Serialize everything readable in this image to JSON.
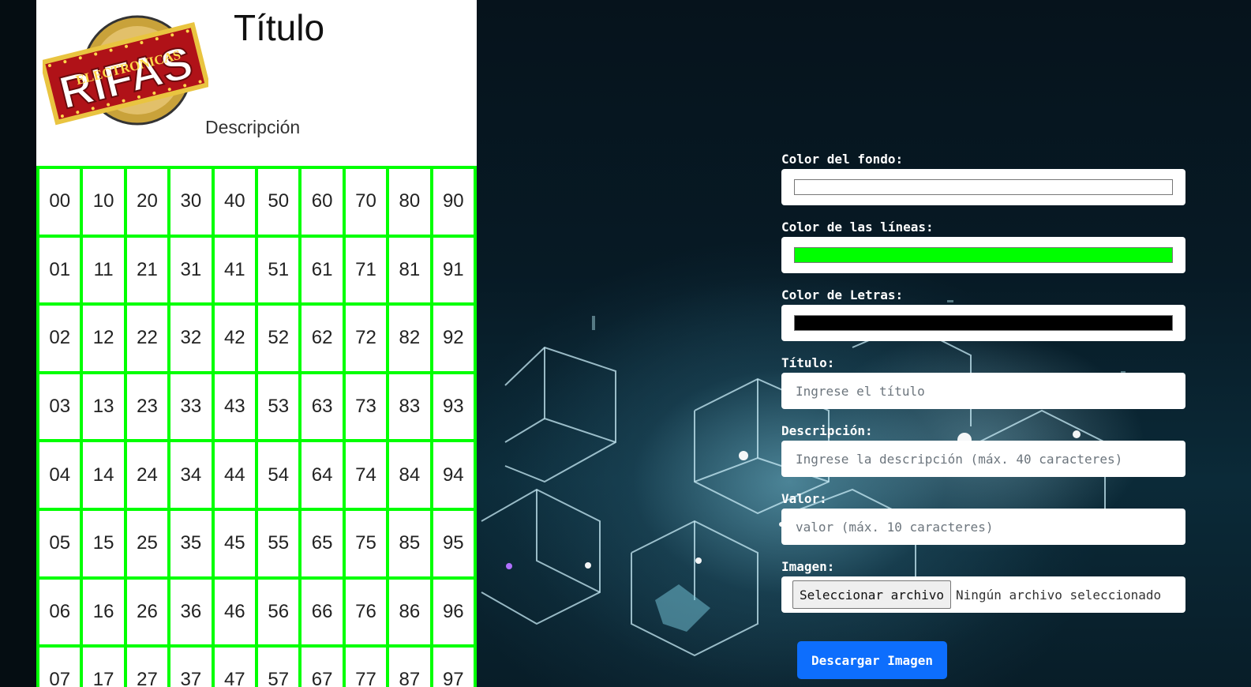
{
  "ticket": {
    "logo_text_main": "RIFAS",
    "logo_text_sub": "ELECTRONICAS",
    "title": "Título",
    "description": "Descripción",
    "numbers": [
      "00",
      "10",
      "20",
      "30",
      "40",
      "50",
      "60",
      "70",
      "80",
      "90",
      "01",
      "11",
      "21",
      "31",
      "41",
      "51",
      "61",
      "71",
      "81",
      "91",
      "02",
      "12",
      "22",
      "32",
      "42",
      "52",
      "62",
      "72",
      "82",
      "92",
      "03",
      "13",
      "23",
      "33",
      "43",
      "53",
      "63",
      "73",
      "83",
      "93",
      "04",
      "14",
      "24",
      "34",
      "44",
      "54",
      "64",
      "74",
      "84",
      "94",
      "05",
      "15",
      "25",
      "35",
      "45",
      "55",
      "65",
      "75",
      "85",
      "95",
      "06",
      "16",
      "26",
      "36",
      "46",
      "56",
      "66",
      "76",
      "86",
      "96",
      "07",
      "17",
      "27",
      "37",
      "47",
      "57",
      "67",
      "77",
      "87",
      "97"
    ],
    "colors": {
      "background": "#ffffff",
      "lines": "#00ff00",
      "letters": "#000000"
    }
  },
  "form": {
    "bg_color_label": "Color del fondo:",
    "bg_color_value": "#ffffff",
    "lines_color_label": "Color de las líneas:",
    "lines_color_value": "#00ff00",
    "letters_color_label": "Color de Letras:",
    "letters_color_value": "#000000",
    "title_label": "Título:",
    "title_placeholder": "Ingrese el título",
    "description_label": "Descripción:",
    "description_placeholder": "Ingrese la descripción (máx. 40 caracteres)",
    "value_label": "Valor:",
    "value_placeholder": "valor (máx. 10 caracteres)",
    "image_label": "Imagen:",
    "file_button_label": "Seleccionar archivo",
    "file_status": "Ningún archivo seleccionado",
    "download_label": "Descargar Imagen"
  }
}
